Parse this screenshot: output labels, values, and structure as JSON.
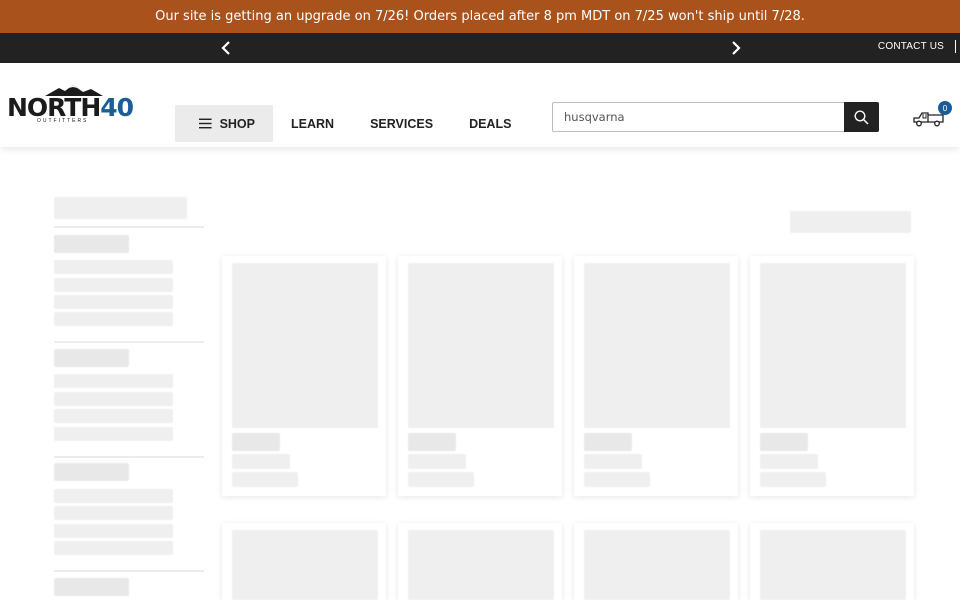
{
  "promo": {
    "message": "Our site is getting an upgrade on 7/26! Orders placed after 8 pm MDT on 7/25 won't ship until 7/28."
  },
  "utility": {
    "prev_icon": "chevron-left-icon",
    "next_icon": "chevron-right-icon",
    "contact_label": "CONTACT US",
    "divider": "|"
  },
  "header": {
    "logo": {
      "word": "NORTH",
      "number": "40",
      "tagline": "OUTFITTERS",
      "icon": "mountain-icon"
    },
    "nav": [
      {
        "label": "SHOP",
        "icon": "menu-icon"
      },
      {
        "label": "LEARN"
      },
      {
        "label": "SERVICES"
      },
      {
        "label": "DEALS"
      }
    ],
    "search": {
      "value": "husqvarna",
      "icon": "search-icon"
    },
    "cart": {
      "icon": "truck-cart-icon",
      "count": "0"
    }
  },
  "colors": {
    "promo_bg": "#a9521c",
    "utility_bg": "#222222",
    "brand_blue": "#1b5e97",
    "skeleton": "#efefef"
  },
  "content_state": "loading-skeleton"
}
